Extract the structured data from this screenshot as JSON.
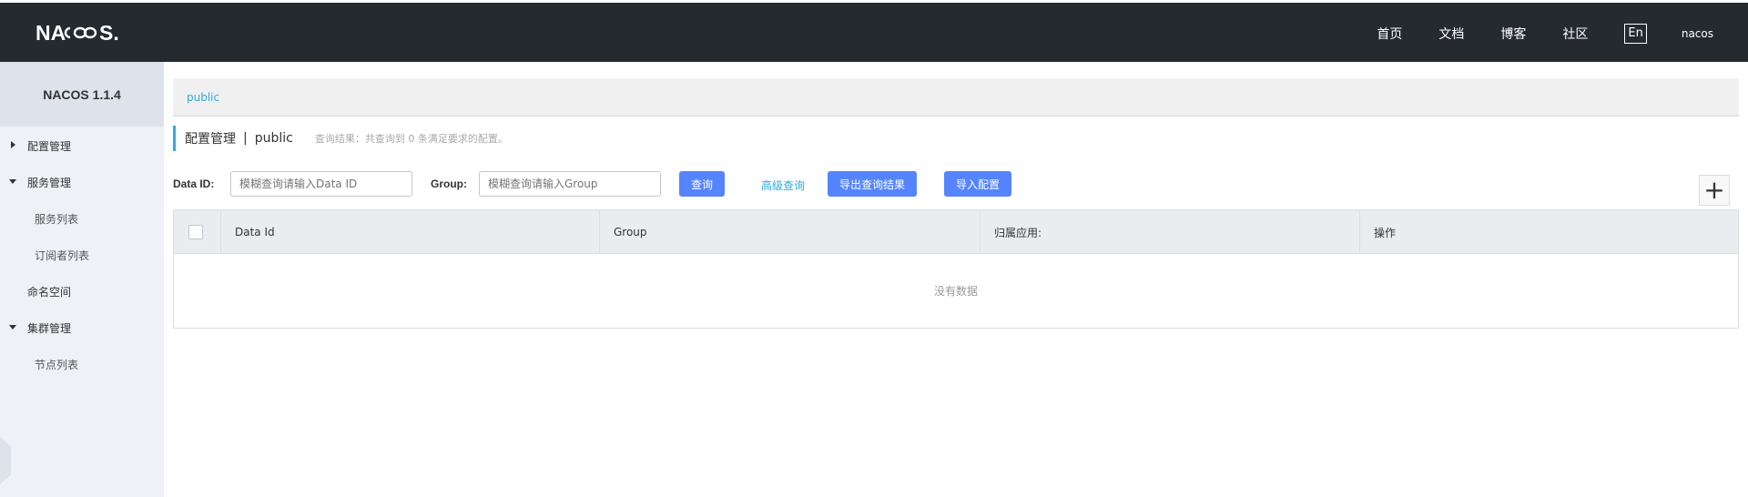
{
  "header": {
    "logo_text": "NACOS",
    "nav": [
      "首页",
      "文档",
      "博客",
      "社区"
    ],
    "lang": "En",
    "user": "nacos"
  },
  "sidebar": {
    "title": "NACOS 1.1.4",
    "items": [
      {
        "label": "配置管理"
      },
      {
        "label": "服务管理"
      },
      {
        "label": "服务列表"
      },
      {
        "label": "订阅者列表"
      },
      {
        "label": "命名空间"
      },
      {
        "label": "集群管理"
      },
      {
        "label": "节点列表"
      }
    ]
  },
  "breadcrumb": {
    "namespace": "public"
  },
  "page": {
    "title": "配置管理",
    "separator": "|",
    "namespace": "public",
    "result_hint": "查询结果：共查询到 0 条满足要求的配置。"
  },
  "filters": {
    "data_id_label": "Data ID:",
    "data_id_placeholder": "模糊查询请输入Data ID",
    "group_label": "Group:",
    "group_placeholder": "模糊查询请输入Group",
    "query_button": "查询",
    "advanced_query": "高级查询",
    "export_button": "导出查询结果",
    "import_button": "导入配置",
    "add_icon": "+"
  },
  "table": {
    "columns": [
      "Data Id",
      "Group",
      "归属应用:",
      "操作"
    ],
    "empty_text": "没有数据"
  },
  "colors": {
    "topbar": "#252a2f",
    "accent": "#2eaadc",
    "primary_button": "#5584ff",
    "sidebar_bg": "#eef1f6"
  }
}
